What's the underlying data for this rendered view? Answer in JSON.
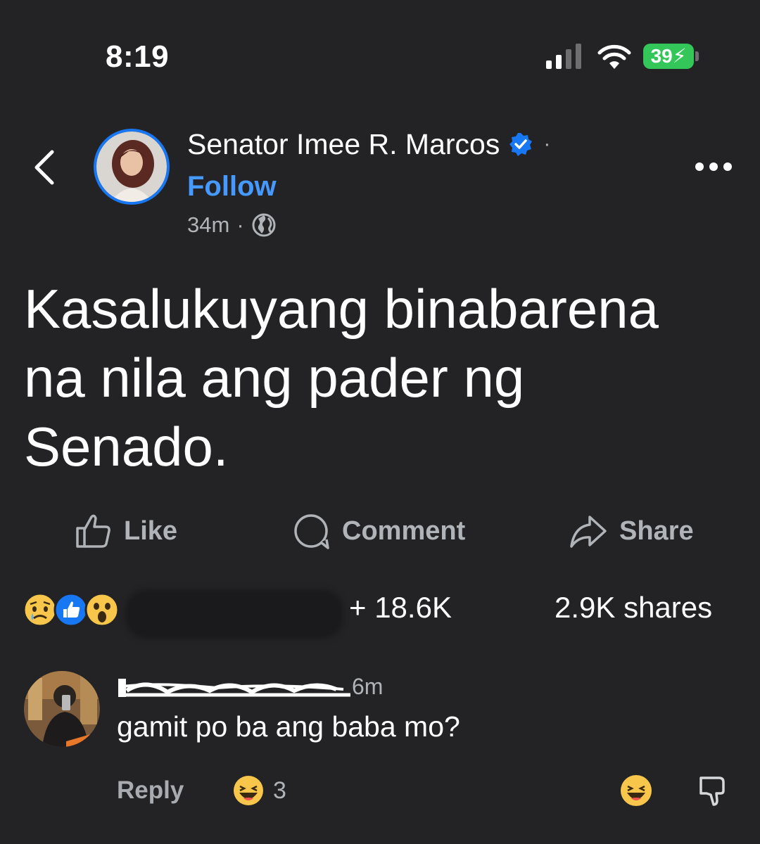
{
  "status_bar": {
    "time": "8:19",
    "battery": "39"
  },
  "post": {
    "author": "Senator Imee R. Marcos",
    "separator": "·",
    "follow_label": "Follow",
    "time": "34m",
    "meta_separator": "·",
    "text": "Kasalukuyang binabarena na nila ang pader ng Senado.",
    "audience_icon": "globe-icon",
    "verified_icon": "verified-badge-icon"
  },
  "actions": {
    "like_label": "Like",
    "comment_label": "Comment",
    "share_label": "Share"
  },
  "summary": {
    "reaction_icons": [
      "sad-reaction",
      "like-reaction",
      "wow-reaction"
    ],
    "reaction_count": "+ 18.6K",
    "shares": "2.9K shares"
  },
  "comment": {
    "time": "6m",
    "text": "gamit po ba ang baba mo?",
    "reply_label": "Reply",
    "reaction_count": "3"
  },
  "colors": {
    "background": "#232325",
    "accent_blue": "#1877f2",
    "link_blue": "#4599ff",
    "battery_green": "#33c759",
    "secondary_text": "#b0b3b8"
  }
}
